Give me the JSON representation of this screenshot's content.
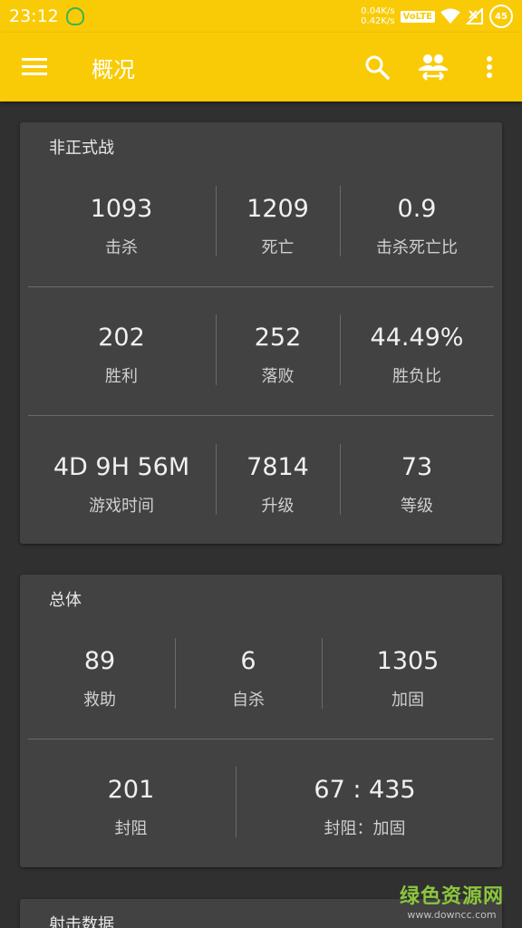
{
  "status_bar": {
    "time": "23:12",
    "net_up": "0.04K/s",
    "net_down": "0.42K/s",
    "lte": "VoLTE",
    "battery": "45"
  },
  "app_bar": {
    "title": "概况",
    "icons": [
      "menu-icon",
      "search-icon",
      "switch-account-icon",
      "more-vert-icon"
    ]
  },
  "cards": [
    {
      "title": "非正式战",
      "rows": [
        [
          {
            "value": "1093",
            "label": "击杀"
          },
          {
            "value": "1209",
            "label": "死亡"
          },
          {
            "value": "0.9",
            "label": "击杀死亡比"
          }
        ],
        [
          {
            "value": "202",
            "label": "胜利"
          },
          {
            "value": "252",
            "label": "落败"
          },
          {
            "value": "44.49%",
            "label": "胜负比"
          }
        ],
        [
          {
            "value": "4D 9H 56M",
            "label": "游戏时间"
          },
          {
            "value": "7814",
            "label": "升级"
          },
          {
            "value": "73",
            "label": "等级"
          }
        ]
      ]
    },
    {
      "title": "总体",
      "rows": [
        [
          {
            "value": "89",
            "label": "救助"
          },
          {
            "value": "6",
            "label": "自杀"
          },
          {
            "value": "1305",
            "label": "加固"
          }
        ],
        [
          {
            "value": "201",
            "label": "封阻"
          },
          {
            "value": "67 : 435",
            "label": "封阻：加固"
          }
        ]
      ]
    },
    {
      "title": "射击数据"
    }
  ],
  "watermark": {
    "main": "绿色资源网",
    "sub": "www.downcc.com"
  },
  "colors": {
    "accent": "#f9cb07",
    "background": "#303030",
    "card": "#424242"
  }
}
